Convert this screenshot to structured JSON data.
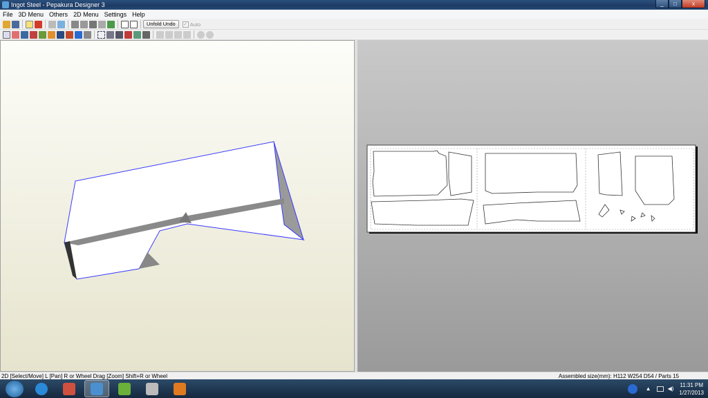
{
  "window": {
    "title": "Ingot Steel - Pepakura Designer 3",
    "minimize": "_",
    "maximize": "□",
    "close": "x"
  },
  "menu": [
    "File",
    "3D Menu",
    "Others",
    "2D Menu",
    "Settings",
    "Help"
  ],
  "toolbar": {
    "unfold_undo": "Unfold Undo",
    "auto_label": "Auto",
    "auto_checked": true,
    "auto_check_glyph": "✓"
  },
  "status": {
    "left": "2D [Select/Move] L [Pan] R or Wheel Drag [Zoom] Shift+R or Wheel",
    "right": "Assembled size(mm): H112 W254 D54 / Parts 15"
  },
  "taskbar": {
    "apps": [
      "internet-explorer",
      "app-red",
      "pepakura-designer",
      "app-green",
      "app-device",
      "app-orange"
    ],
    "time": "11:31 PM",
    "date": "1/27/2013"
  },
  "colors": {
    "edge": "#3a3aff",
    "accent": "#1d3a63"
  }
}
